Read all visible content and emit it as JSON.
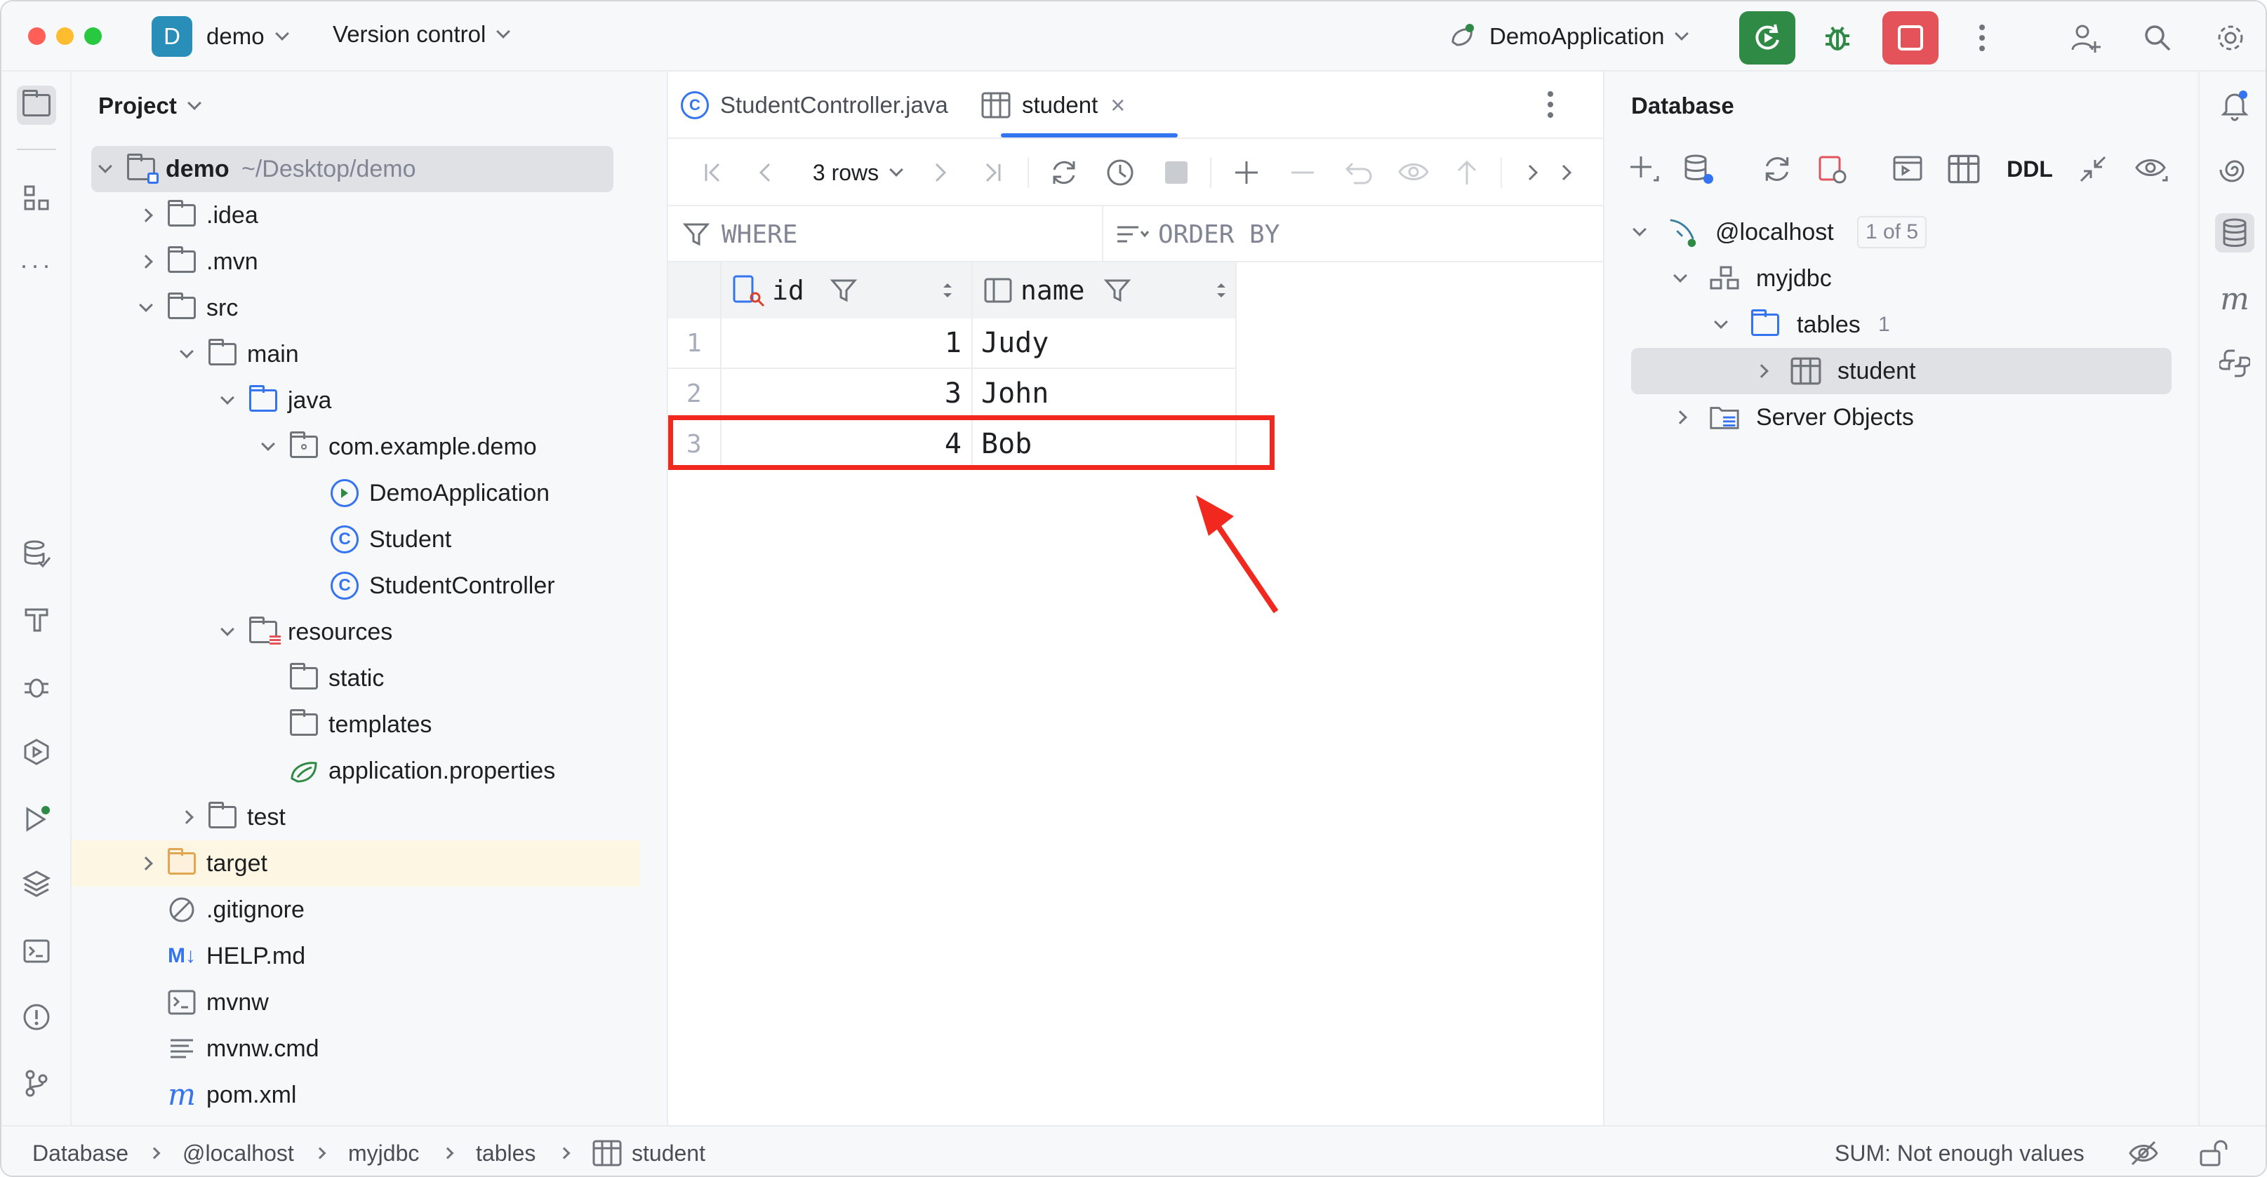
{
  "titlebar": {
    "project_badge": "D",
    "project_name": "demo",
    "vcs_label": "Version control",
    "run_config": "DemoApplication"
  },
  "project_panel": {
    "title": "Project",
    "tree": [
      {
        "label": "demo",
        "hint": "~/Desktop/demo",
        "depth": 0,
        "expanded": true,
        "icon": "module-folder-icon",
        "selected": true
      },
      {
        "label": ".idea",
        "depth": 1,
        "expanded": false,
        "icon": "folder-icon"
      },
      {
        "label": ".mvn",
        "depth": 1,
        "expanded": false,
        "icon": "folder-icon"
      },
      {
        "label": "src",
        "depth": 1,
        "expanded": true,
        "icon": "folder-icon"
      },
      {
        "label": "main",
        "depth": 2,
        "expanded": true,
        "icon": "folder-icon"
      },
      {
        "label": "java",
        "depth": 3,
        "expanded": true,
        "icon": "source-folder-icon"
      },
      {
        "label": "com.example.demo",
        "depth": 4,
        "expanded": true,
        "icon": "package-icon"
      },
      {
        "label": "DemoApplication",
        "depth": 5,
        "icon": "spring-class-icon"
      },
      {
        "label": "Student",
        "depth": 5,
        "icon": "class-icon"
      },
      {
        "label": "StudentController",
        "depth": 5,
        "icon": "class-icon"
      },
      {
        "label": "resources",
        "depth": 3,
        "expanded": true,
        "icon": "resources-folder-icon"
      },
      {
        "label": "static",
        "depth": 4,
        "icon": "folder-icon"
      },
      {
        "label": "templates",
        "depth": 4,
        "icon": "folder-icon"
      },
      {
        "label": "application.properties",
        "depth": 4,
        "icon": "spring-properties-icon"
      },
      {
        "label": "test",
        "depth": 2,
        "expanded": false,
        "icon": "folder-icon"
      },
      {
        "label": "target",
        "depth": 1,
        "expanded": false,
        "icon": "excluded-folder-icon",
        "highlighted": true
      },
      {
        "label": ".gitignore",
        "depth": 1,
        "icon": "ignore-file-icon"
      },
      {
        "label": "HELP.md",
        "depth": 1,
        "icon": "markdown-icon"
      },
      {
        "label": "mvnw",
        "depth": 1,
        "icon": "shell-script-icon"
      },
      {
        "label": "mvnw.cmd",
        "depth": 1,
        "icon": "text-file-icon"
      },
      {
        "label": "pom.xml",
        "depth": 1,
        "icon": "maven-icon"
      }
    ]
  },
  "editor": {
    "tabs": [
      {
        "label": "StudentController.java",
        "active": false
      },
      {
        "label": "student",
        "active": true
      }
    ],
    "rows_label": "3 rows",
    "filter_where": "WHERE",
    "filter_order": "ORDER BY",
    "columns": [
      {
        "name": "id"
      },
      {
        "name": "name"
      }
    ],
    "rows": [
      {
        "num": "1",
        "id": "1",
        "name": "Judy"
      },
      {
        "num": "2",
        "id": "3",
        "name": "John"
      },
      {
        "num": "3",
        "id": "4",
        "name": "Bob"
      }
    ]
  },
  "database_panel": {
    "title": "Database",
    "ddl_label": "DDL",
    "tree": {
      "host": "@localhost",
      "host_count": "1 of 5",
      "schema": "myjdbc",
      "tables_label": "tables",
      "tables_count": "1",
      "table": "student",
      "server_objects": "Server Objects"
    }
  },
  "statusbar": {
    "breadcrumbs": [
      "Database",
      "@localhost",
      "myjdbc",
      "tables",
      "student"
    ],
    "sum": "SUM: Not enough values"
  },
  "colors": {
    "accent": "#3574f0",
    "run_green": "#2e8a44",
    "stop_red": "#e5535a",
    "annotation_red": "#f0281e",
    "highlight_row": "#fdf6e3"
  }
}
